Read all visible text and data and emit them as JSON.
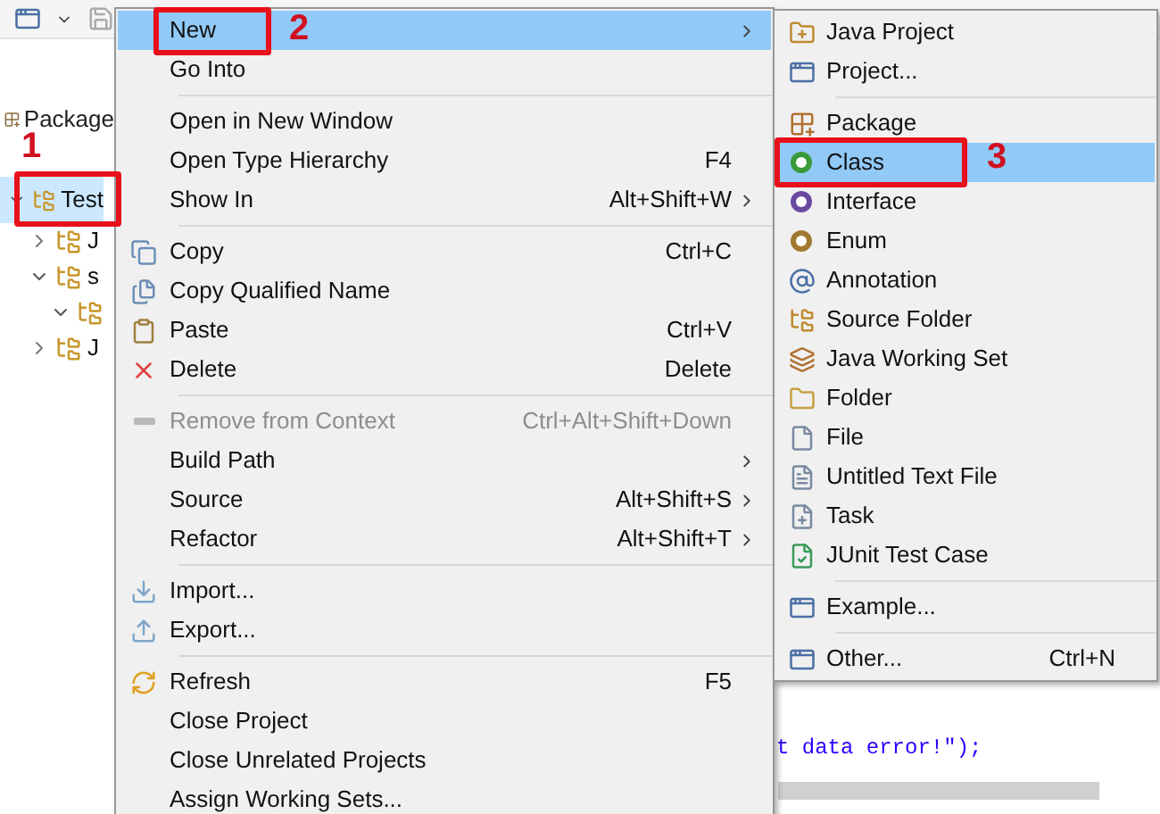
{
  "package_explorer": {
    "title": "Package",
    "tree": [
      {
        "label": "Test",
        "selected": true,
        "expanded": true,
        "children": [
          {
            "label": "J",
            "selected": false,
            "expanded": false
          },
          {
            "label": "s",
            "selected": false,
            "expanded": true,
            "children": [
              {
                "selected": false,
                "expanded": true
              }
            ]
          },
          {
            "label": "J",
            "selected": false,
            "expanded": false
          }
        ]
      }
    ]
  },
  "context_menu": [
    {
      "kind": "item",
      "label": "New",
      "selected": true,
      "submenu": true
    },
    {
      "kind": "item",
      "label": "Go Into",
      "selected": false
    },
    {
      "kind": "separator"
    },
    {
      "kind": "item",
      "label": "Open in New Window",
      "selected": false
    },
    {
      "kind": "item",
      "label": "Open Type Hierarchy",
      "shortcut": "F4",
      "selected": false
    },
    {
      "kind": "item",
      "label": "Show In",
      "shortcut": "Alt+Shift+W",
      "selected": false,
      "submenu": true
    },
    {
      "kind": "separator"
    },
    {
      "kind": "item",
      "label": "Copy",
      "shortcut": "Ctrl+C",
      "selected": false
    },
    {
      "kind": "item",
      "label": "Copy Qualified Name",
      "selected": false
    },
    {
      "kind": "item",
      "label": "Paste",
      "shortcut": "Ctrl+V",
      "selected": false
    },
    {
      "kind": "item",
      "label": "Delete",
      "shortcut": "Delete",
      "selected": false
    },
    {
      "kind": "separator"
    },
    {
      "kind": "item",
      "label": "Remove from Context",
      "shortcut": "Ctrl+Alt+Shift+Down",
      "selected": false,
      "disabled": true
    },
    {
      "kind": "item",
      "label": "Build Path",
      "selected": false,
      "submenu": true
    },
    {
      "kind": "item",
      "label": "Source",
      "shortcut": "Alt+Shift+S",
      "selected": false,
      "submenu": true
    },
    {
      "kind": "item",
      "label": "Refactor",
      "shortcut": "Alt+Shift+T",
      "selected": false,
      "submenu": true
    },
    {
      "kind": "separator"
    },
    {
      "kind": "item",
      "label": "Import...",
      "selected": false
    },
    {
      "kind": "item",
      "label": "Export...",
      "selected": false
    },
    {
      "kind": "separator"
    },
    {
      "kind": "item",
      "label": "Refresh",
      "shortcut": "F5",
      "selected": false
    },
    {
      "kind": "item",
      "label": "Close Project",
      "selected": false
    },
    {
      "kind": "item",
      "label": "Close Unrelated Projects",
      "selected": false
    },
    {
      "kind": "item",
      "label": "Assign Working Sets...",
      "selected": false
    }
  ],
  "new_submenu": [
    {
      "kind": "item",
      "label": "Java Project",
      "selected": false
    },
    {
      "kind": "item",
      "label": "Project...",
      "selected": false
    },
    {
      "kind": "separator"
    },
    {
      "kind": "item",
      "label": "Package",
      "selected": false
    },
    {
      "kind": "item",
      "label": "Class",
      "selected": true
    },
    {
      "kind": "item",
      "label": "Interface",
      "selected": false
    },
    {
      "kind": "item",
      "label": "Enum",
      "selected": false
    },
    {
      "kind": "item",
      "label": "Annotation",
      "selected": false
    },
    {
      "kind": "item",
      "label": "Source Folder",
      "selected": false
    },
    {
      "kind": "item",
      "label": "Java Working Set",
      "selected": false
    },
    {
      "kind": "item",
      "label": "Folder",
      "selected": false
    },
    {
      "kind": "item",
      "label": "File",
      "selected": false
    },
    {
      "kind": "item",
      "label": "Untitled Text File",
      "selected": false
    },
    {
      "kind": "item",
      "label": "Task",
      "selected": false
    },
    {
      "kind": "item",
      "label": "JUnit Test Case",
      "selected": false
    },
    {
      "kind": "separator"
    },
    {
      "kind": "item",
      "label": "Example...",
      "selected": false
    },
    {
      "kind": "separator"
    },
    {
      "kind": "item",
      "label": "Other...",
      "shortcut": "Ctrl+N",
      "selected": false
    }
  ],
  "editor": {
    "lines": [
      "t data error!\");"
    ]
  },
  "callouts": [
    {
      "number": "1"
    },
    {
      "number": "2"
    },
    {
      "number": "3"
    }
  ]
}
